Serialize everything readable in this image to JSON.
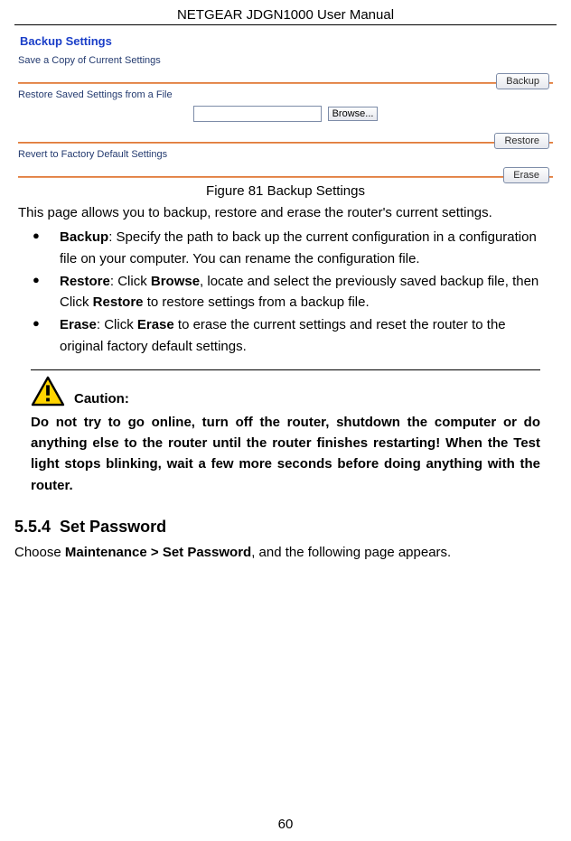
{
  "header": {
    "title": "NETGEAR JDGN1000 User Manual"
  },
  "screenshot": {
    "title": "Backup Settings",
    "save_label": "Save a Copy of Current Settings",
    "backup_btn": "Backup",
    "restore_label": "Restore Saved Settings from a File",
    "browse_btn": "Browse...",
    "restore_btn": "Restore",
    "revert_label": "Revert to Factory Default Settings",
    "erase_btn": "Erase"
  },
  "figure_caption": "Figure 81 Backup Settings",
  "intro": "This page allows you to backup, restore and erase the router's current settings.",
  "bullets": {
    "b1": {
      "term": "Backup",
      "text": ": Specify the path to back up the current configuration in a configuration file on your computer. You can rename the configuration file."
    },
    "b2": {
      "term": "Restore",
      "pre": ": Click ",
      "mid1": "Browse",
      "mid2": ", locate and select the previously saved backup file, then Click ",
      "mid3": "Restore",
      "post": " to restore settings from a backup file."
    },
    "b3": {
      "term": "Erase",
      "pre": ": Click ",
      "mid": "Erase",
      "post": " to erase the current settings and reset the router to the original factory default settings."
    }
  },
  "caution": {
    "label": "Caution:",
    "text": "Do not try to go online, turn off the router, shutdown the computer or do anything else to the router until the router finishes restarting! When the Test light stops blinking, wait a few more seconds before doing anything with the router."
  },
  "section": {
    "number": "5.5.4",
    "title": "Set Password",
    "intro_pre": "Choose ",
    "intro_bold": "Maintenance > Set Password",
    "intro_post": ", and the following page appears."
  },
  "page_number": "60"
}
